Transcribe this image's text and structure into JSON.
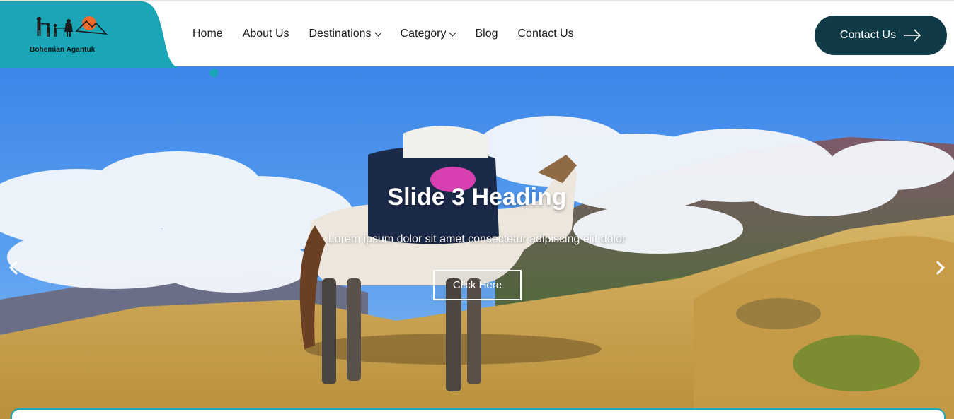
{
  "brand": {
    "name": "Bohemian Agantuk",
    "accent": "#1aa6b7",
    "dark": "#0f3a46",
    "sun": "#f06a2a"
  },
  "nav": {
    "items": [
      {
        "label": "Home",
        "dropdown": false
      },
      {
        "label": "About Us",
        "dropdown": false
      },
      {
        "label": "Destinations",
        "dropdown": true
      },
      {
        "label": "Category",
        "dropdown": true
      },
      {
        "label": "Blog",
        "dropdown": false
      },
      {
        "label": "Contact Us",
        "dropdown": false
      }
    ]
  },
  "header": {
    "cta_label": "Contact Us",
    "cta_icon": "arrow-right-icon"
  },
  "hero": {
    "title": "Slide 3 Heading",
    "subtitle": "Lorem ipsum dolor sit amet consectetur adipiscing elit dolor",
    "button_label": "Click Here",
    "prev_icon": "chevron-left-icon",
    "next_icon": "chevron-right-icon"
  }
}
